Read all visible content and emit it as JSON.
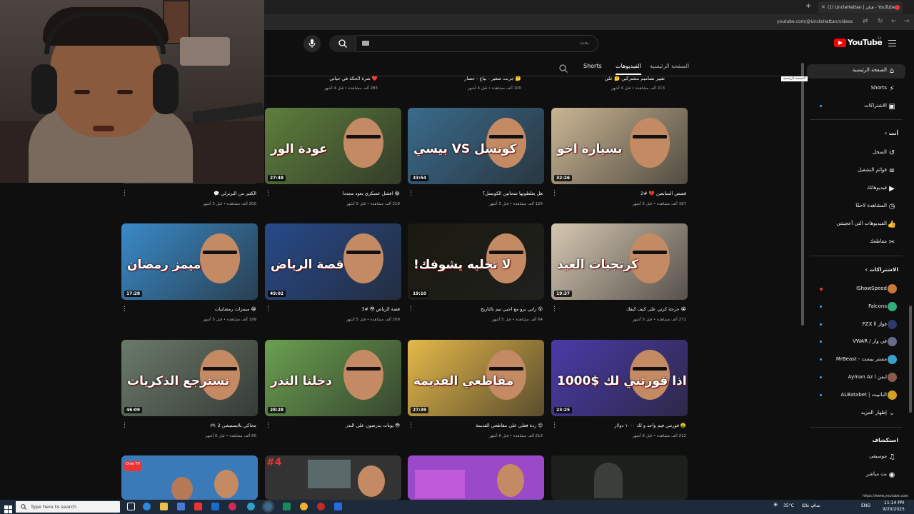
{
  "browser": {
    "tab_title": "(1) UncleHattan | هتان - YouTube",
    "url": "youtube.com/@UncleHattan/videos"
  },
  "header": {
    "logo_text": "YouTube",
    "logo_region": "SA",
    "search_placeholder": "بحث"
  },
  "channel_tabs": {
    "home": "الصفحة الرئيسية",
    "videos": "الفيديوهات",
    "shorts": "Shorts"
  },
  "tooltip": "الصفحة الرئيسية",
  "top_row": [
    {
      "title": "تغيير تصاميم مشتركين 🤔 علي",
      "meta": "213 ألف مشاهدة • قبل 4 أشهر"
    },
    {
      "title": "🤔 جربت صغير - بياع - حصار",
      "meta": "100 ألف مشاهدة • قبل 4 أشهر"
    },
    {
      "title": "❤️ شرة الحكة في حياتي",
      "meta": "283 ألف مشاهدة • قبل 4 أشهر"
    }
  ],
  "videos": [
    {
      "title": "قصص المتابعين 💔 #2",
      "meta": "187 ألف مشاهدة • قبل 5 أشهر",
      "duration": "32:26",
      "overlay": "بسيارة اخو",
      "bg": "#c9b592"
    },
    {
      "title": "هل يغلطونها شحاتين الكونسل؟",
      "meta": "126 ألف مشاهدة • قبل 5 أشهر",
      "duration": "33:54",
      "overlay": "كونسل VS بيسي",
      "bg": "#3a6b8c"
    },
    {
      "title": "😂 افشل عسكري يعود مجددا",
      "meta": "219 ألف مشاهدة • قبل 5 أشهر",
      "duration": "27:48",
      "overlay": "عودة الور",
      "bg": "#5e7f3c"
    },
    {
      "title": "الكثير من البربرلي 💬",
      "meta": "200 ألف مشاهدة • قبل 5 أشهر",
      "duration": "",
      "overlay": "",
      "bg": "#2a2a2a"
    },
    {
      "title": "😭 جرحة كرتي على كيف كيفك",
      "meta": "271 ألف مشاهدة • قبل 5 أشهر",
      "duration": "19:37",
      "overlay": "كرتجيات العيد",
      "bg": "#d6c7b2"
    },
    {
      "title": "😵 رابي برو مع اجبي تيم بالتاريخ",
      "meta": "64 ألف مشاهدة • قبل 5 أشهر",
      "duration": "19:10",
      "overlay": "لا تخليه يشوفك!",
      "bg": "#1a1a10"
    },
    {
      "title": "قصة الرياض 😳 #3",
      "meta": "209 ألف مشاهدة • قبل 5 أشهر",
      "duration": "49:02",
      "overlay": "قصة الرياض",
      "bg": "#274a8a"
    },
    {
      "title": "😂 ميمزات رمضانيات",
      "meta": "199 ألف مشاهدة • قبل 5 أشهر",
      "duration": "17:28",
      "overlay": "ميمز رمضان",
      "bg": "#3a8ac8"
    },
    {
      "title": "🤑 فورتني فيم واحد و لك ١٠٠٠ دولار",
      "meta": "212 ألف مشاهدة • قبل 6 أشهر",
      "duration": "23:25",
      "overlay": "اذا فورتني لك $1000",
      "bg": "#4a3aa8"
    },
    {
      "title": "😊 ردة فعلي على مقاطعي القديمة",
      "meta": "212 ألف مشاهدة • قبل 6 أشهر",
      "duration": "27:39",
      "overlay": "مقاطعي القديمة",
      "bg": "#e4b84a"
    },
    {
      "title": "😳 يوتات يدرصون على النذر",
      "meta": "",
      "duration": "28:28",
      "overlay": "دخلنا النذر",
      "bg": "#6aa050"
    },
    {
      "title": "محاكي بلايستيشن 2 🎮",
      "meta": "80 ألف مشاهدة • قبل 6 أشهر",
      "duration": "46:09",
      "overlay": "نسترجع الذكريات",
      "bg": "#6a7a6a"
    }
  ],
  "sidebar": {
    "main": [
      {
        "label": "الصفحة الرئيسية",
        "icon": "home-icon"
      },
      {
        "label": "Shorts",
        "icon": "shorts-icon"
      },
      {
        "label": "الاشتراكات",
        "icon": "subscriptions-icon"
      }
    ],
    "you_heading": "أنت",
    "you": [
      {
        "label": "السجل",
        "icon": "history-icon"
      },
      {
        "label": "قوائم التشغيل",
        "icon": "playlist-icon"
      },
      {
        "label": "فيديوهاتك",
        "icon": "your-videos-icon"
      },
      {
        "label": "المشاهدة لاحقًا",
        "icon": "watch-later-icon"
      },
      {
        "label": "الفيديوهات التي أعجبتني",
        "icon": "like-icon"
      },
      {
        "label": "مقاطعك",
        "icon": "clips-icon"
      }
    ],
    "subs_heading": "الاشتراكات",
    "subs": [
      {
        "label": "IShowSpeed",
        "color": "#c8783a"
      },
      {
        "label": "Falcons",
        "color": "#2fae7a"
      },
      {
        "label": "فواز FZX ll",
        "color": "#2a3a6a"
      },
      {
        "label": "في وار / VWAR",
        "color": "#6a6a8a"
      },
      {
        "label": "مستر بيست - MrBeast",
        "color": "#3aa0c8"
      },
      {
        "label": "ايمن Ayman Az l",
        "color": "#8a5a4a"
      },
      {
        "label": "الباتبيت | ALBatabet",
        "color": "#d4a020"
      }
    ],
    "show_more": "إظهار المزيد",
    "explore_heading": "استكشاف",
    "explore": [
      {
        "label": "موسيقى",
        "icon": "music-icon"
      },
      {
        "label": "بث مباشر",
        "icon": "live-icon"
      }
    ]
  },
  "taskbar": {
    "search": "Type here to search",
    "temp": "35°C",
    "weather": "صافٍ غالبًا",
    "lang": "ENG",
    "time": "11:14 PM",
    "date": "9/20/2025",
    "status_url": "https://www.youtube.com"
  }
}
